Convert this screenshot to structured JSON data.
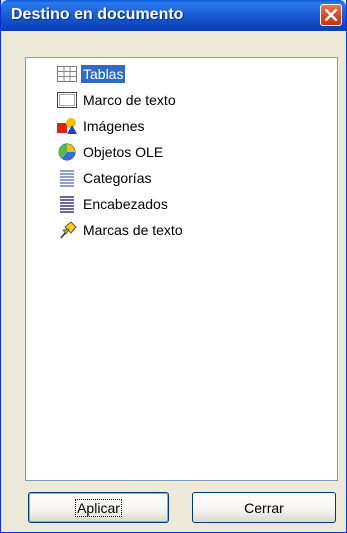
{
  "window": {
    "title": "Destino en documento"
  },
  "tree": {
    "items": [
      {
        "label": "Tablas",
        "icon": "table-icon",
        "selected": true
      },
      {
        "label": "Marco de texto",
        "icon": "frame-icon"
      },
      {
        "label": "Imágenes",
        "icon": "images-icon"
      },
      {
        "label": "Objetos OLE",
        "icon": "ole-object-icon"
      },
      {
        "label": "Categorías",
        "icon": "category-icon"
      },
      {
        "label": "Encabezados",
        "icon": "heading-icon"
      },
      {
        "label": "Marcas de texto",
        "icon": "bookmark-icon"
      }
    ]
  },
  "buttons": {
    "apply": "Aplicar",
    "close": "Cerrar"
  }
}
